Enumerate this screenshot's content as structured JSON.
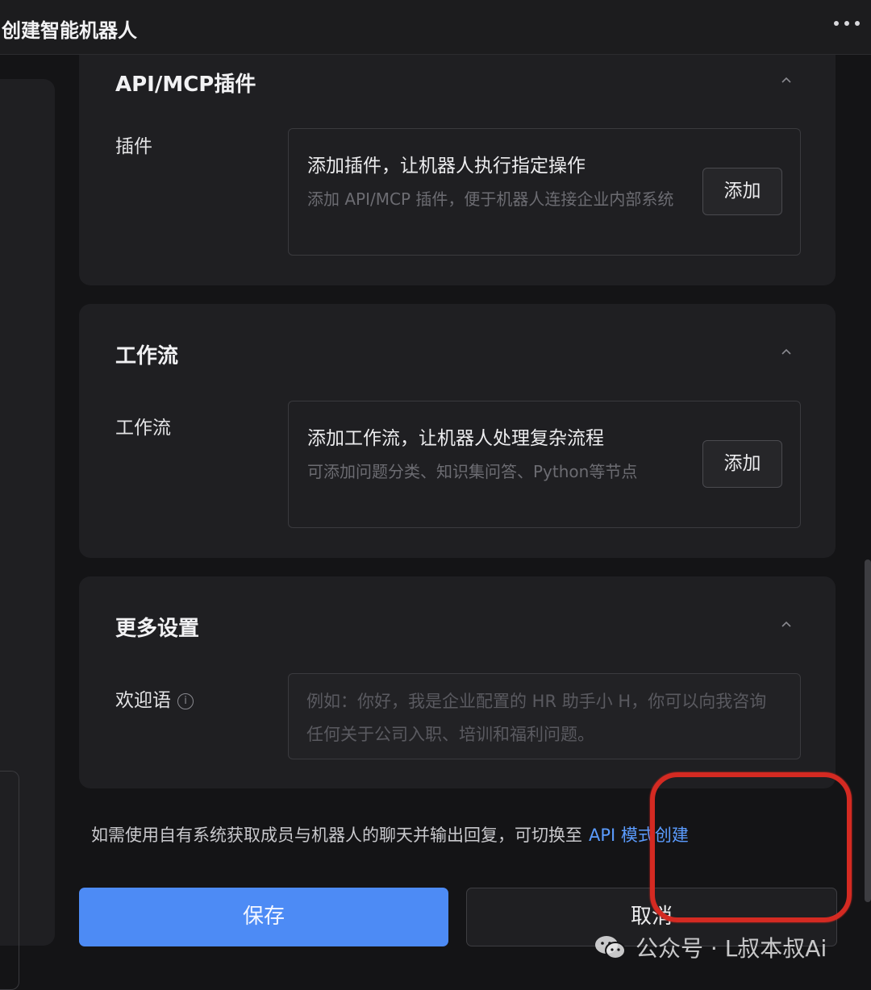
{
  "window": {
    "title": "创建智能机器人"
  },
  "sections": {
    "plugins": {
      "title": "API/MCP插件",
      "field_label": "插件",
      "box_title": "添加插件，让机器人执行指定操作",
      "box_desc": "添加 API/MCP 插件，便于机器人连接企业内部系统",
      "add_label": "添加"
    },
    "workflow": {
      "title": "工作流",
      "field_label": "工作流",
      "box_title": "添加工作流，让机器人处理复杂流程",
      "box_desc": "可添加问题分类、知识集问答、Python等节点",
      "add_label": "添加"
    },
    "more_settings": {
      "title": "更多设置",
      "welcome_label": "欢迎语",
      "welcome_placeholder": "例如：你好，我是企业配置的 HR 助手小 H，你可以向我咨询任何关于公司入职、培训和福利问题。"
    }
  },
  "hint": {
    "text": "如需使用自有系统获取成员与机器人的聊天并输出回复，可切换至",
    "link": "API 模式创建"
  },
  "actions": {
    "save_label": "保存",
    "cancel_label": "取消"
  },
  "watermark": {
    "text": "公众号 · L叔本叔Ai",
    "icon": "wechat-icon"
  },
  "colors": {
    "primary": "#4d8bf5",
    "link": "#5b9cff",
    "annotation": "#d42a22",
    "background": "#141416",
    "card": "#1f1f22"
  }
}
